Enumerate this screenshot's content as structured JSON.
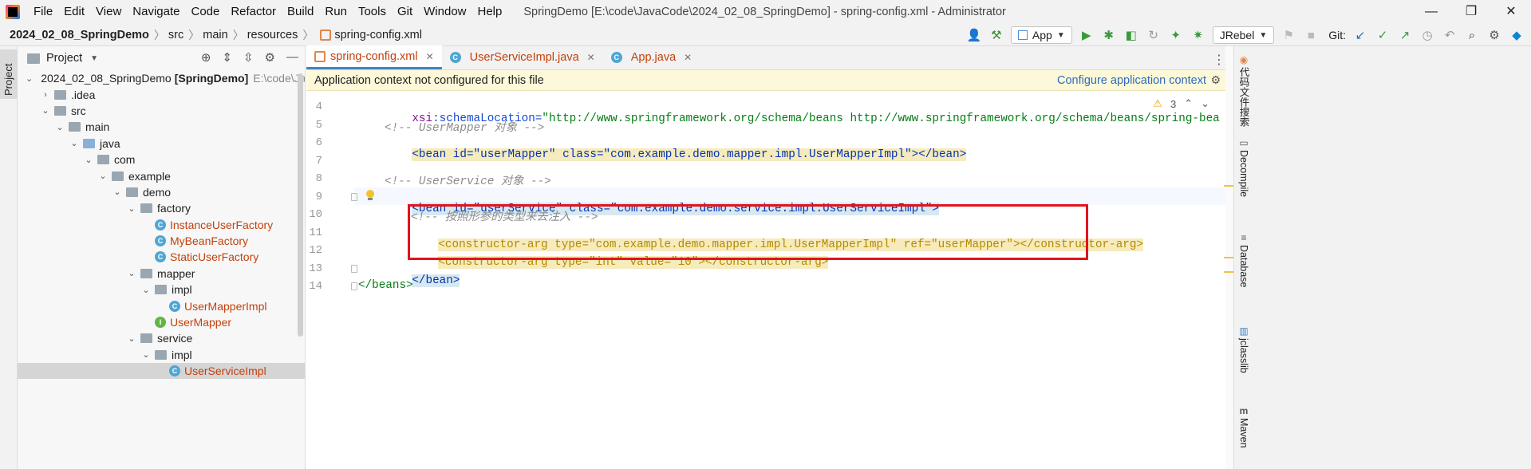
{
  "menu": [
    "File",
    "Edit",
    "View",
    "Navigate",
    "Code",
    "Refactor",
    "Build",
    "Run",
    "Tools",
    "Git",
    "Window",
    "Help"
  ],
  "window_title": "SpringDemo [E:\\code\\JavaCode\\2024_02_08_SpringDemo] - spring-config.xml - Administrator",
  "window_controls": {
    "minimize": "—",
    "maximize": "❐",
    "close": "✕"
  },
  "breadcrumb": [
    "2024_02_08_SpringDemo",
    "src",
    "main",
    "resources",
    "spring-config.xml"
  ],
  "toolbar": {
    "run_config": "App",
    "jrebel": "JRebel",
    "git_label": "Git:"
  },
  "left_strip": {
    "project_tab": "Project"
  },
  "project_panel": {
    "title": "Project",
    "tree": [
      {
        "label": "2024_02_08_SpringDemo",
        "module": "[SpringDemo]",
        "path": "E:\\code\\Java",
        "level": 0,
        "expanded": true,
        "kind": "module"
      },
      {
        "label": ".idea",
        "level": 1,
        "expanded": false,
        "kind": "folder"
      },
      {
        "label": "src",
        "level": 1,
        "expanded": true,
        "kind": "folder"
      },
      {
        "label": "main",
        "level": 2,
        "expanded": true,
        "kind": "folder"
      },
      {
        "label": "java",
        "level": 3,
        "expanded": true,
        "kind": "src-folder"
      },
      {
        "label": "com",
        "level": 4,
        "expanded": true,
        "kind": "package"
      },
      {
        "label": "example",
        "level": 5,
        "expanded": true,
        "kind": "package"
      },
      {
        "label": "demo",
        "level": 6,
        "expanded": true,
        "kind": "package"
      },
      {
        "label": "factory",
        "level": 7,
        "expanded": true,
        "kind": "package"
      },
      {
        "label": "InstanceUserFactory",
        "level": 8,
        "kind": "class"
      },
      {
        "label": "MyBeanFactory",
        "level": 8,
        "kind": "class"
      },
      {
        "label": "StaticUserFactory",
        "level": 8,
        "kind": "class"
      },
      {
        "label": "mapper",
        "level": 7,
        "expanded": true,
        "kind": "package"
      },
      {
        "label": "impl",
        "level": 8,
        "expanded": true,
        "kind": "package"
      },
      {
        "label": "UserMapperImpl",
        "level": 9,
        "kind": "class"
      },
      {
        "label": "UserMapper",
        "level": 8,
        "kind": "interface"
      },
      {
        "label": "service",
        "level": 7,
        "expanded": true,
        "kind": "package"
      },
      {
        "label": "impl",
        "level": 8,
        "expanded": true,
        "kind": "package"
      },
      {
        "label": "UserServiceImpl",
        "level": 9,
        "kind": "class",
        "selected": true
      }
    ]
  },
  "editor_tabs": [
    {
      "label": "spring-config.xml",
      "type": "xml",
      "active": true
    },
    {
      "label": "UserServiceImpl.java",
      "type": "class",
      "active": false
    },
    {
      "label": "App.java",
      "type": "class",
      "active": false
    }
  ],
  "banner": {
    "message": "Application context not configured for this file",
    "action": "Configure application context"
  },
  "inspection": {
    "warnings": "3"
  },
  "code": {
    "line4": "    xsi:schemaLocation=\"http://www.springframework.org/schema/beans http://www.springframework.org/schema/beans/spring-bea",
    "line5": "<!-- UserMapper 对象 -->",
    "line6": "<bean id=\"userMapper\" class=\"com.example.demo.mapper.impl.UserMapperImpl\"></bean>",
    "line8": "<!-- UserService 对象 -->",
    "line9": "<bean id=\"userService\" class=\"com.example.demo.service.impl.UserServiceImpl\">",
    "line10": "<!-- 按照形参的类型来去注入 -->",
    "line11": "<constructor-arg type=\"com.example.demo.mapper.impl.UserMapperImpl\" ref=\"userMapper\"></constructor-arg>",
    "line12": "<constructor-arg type=\"int\" value=\"10\"></constructor-arg>",
    "line13": "</bean>",
    "line14": "</beans>"
  },
  "line_numbers": [
    "4",
    "5",
    "6",
    "7",
    "8",
    "9",
    "10",
    "11",
    "12",
    "13",
    "14"
  ],
  "right_strip": [
    "代码文件搜索",
    "Decompile",
    "Database",
    "jclasslib",
    "Maven"
  ]
}
